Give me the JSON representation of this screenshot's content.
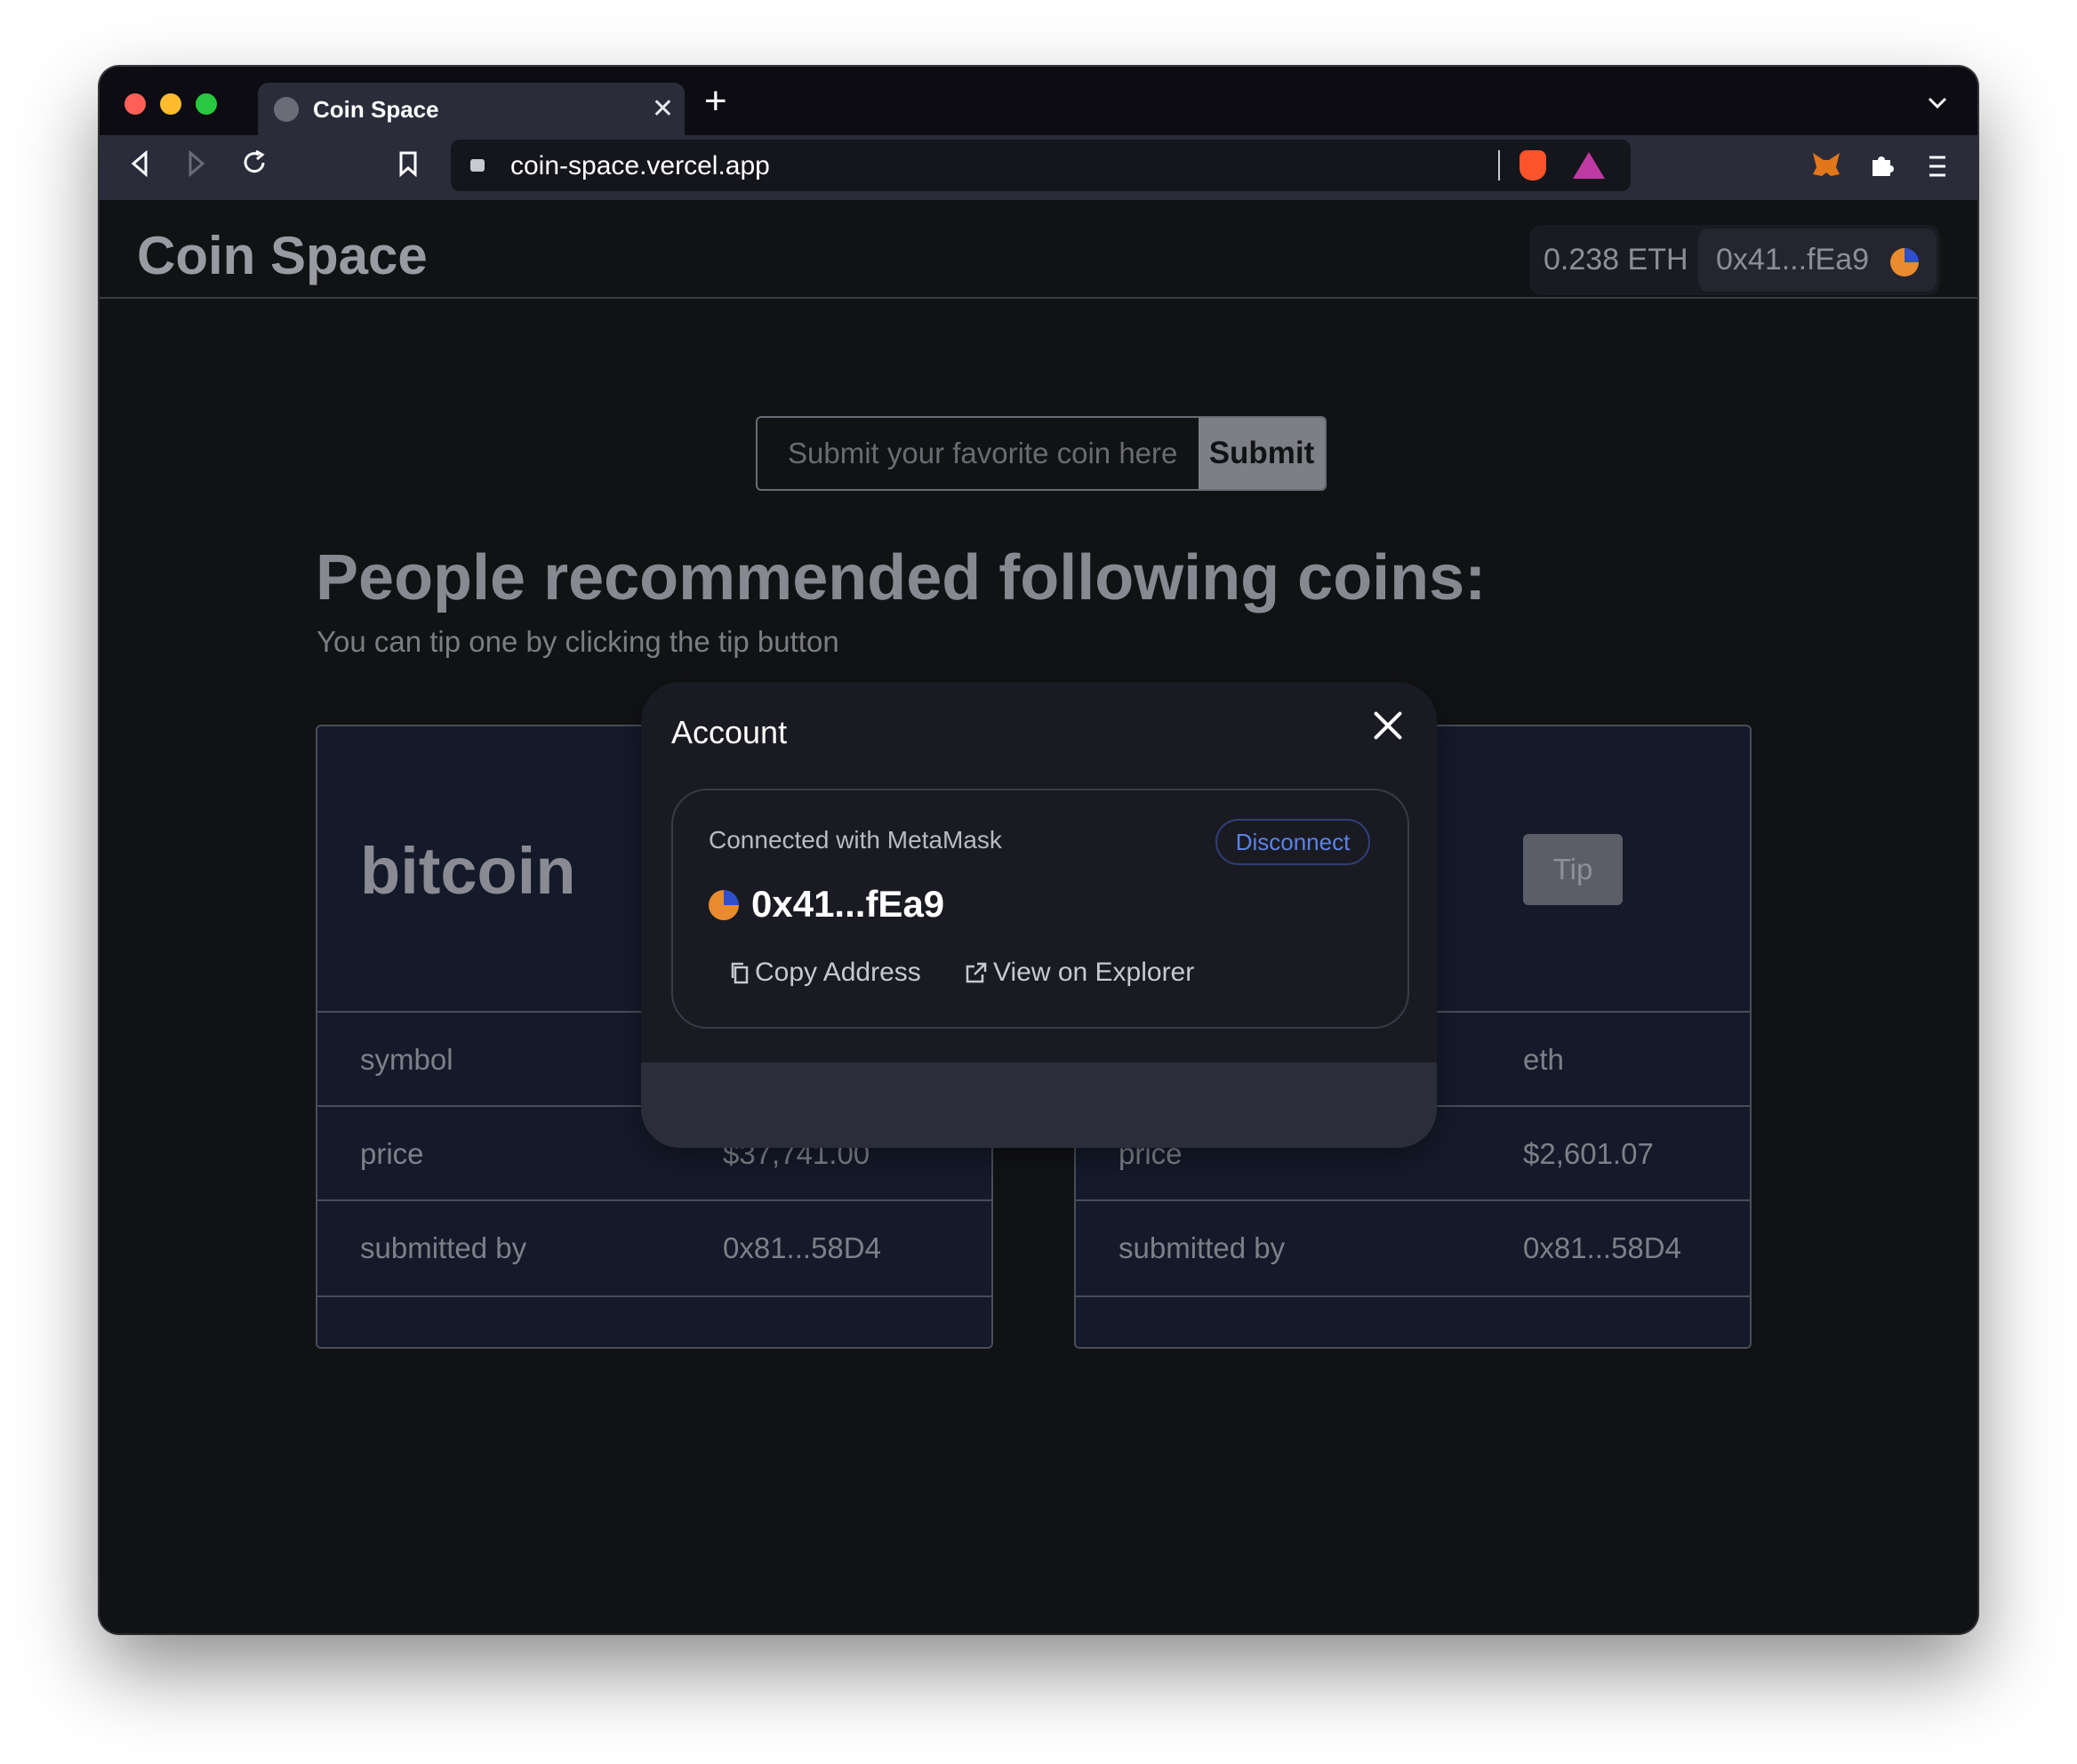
{
  "browser": {
    "tab_title": "Coin Space",
    "tab_close": "✕",
    "new_tab": "+",
    "url": "coin-space.vercel.app"
  },
  "app": {
    "logo": "Coin Space",
    "balance": "0.238 ETH",
    "address": "0x41...fEa9"
  },
  "form": {
    "placeholder": "Submit your favorite coin here",
    "submit_label": "Submit"
  },
  "headline": "People recommended following coins:",
  "subline": "You can tip one by clicking the tip button",
  "cards": [
    {
      "name": "bitcoin",
      "symbol_label": "symbol",
      "symbol": "",
      "price_label": "price",
      "price": "$37,741.00",
      "submitter_label": "submitted by",
      "submitter": "0x81...58D4"
    },
    {
      "name": "",
      "tip_label": "Tip",
      "symbol_label": "",
      "symbol": "eth",
      "price_label": "price",
      "price": "$2,601.07",
      "submitter_label": "submitted by",
      "submitter": "0x81...58D4"
    }
  ],
  "modal": {
    "title": "Account",
    "connected": "Connected with MetaMask",
    "disconnect": "Disconnect",
    "address": "0x41...fEa9",
    "copy_label": "Copy Address",
    "explorer_label": "View on Explorer"
  },
  "colors": {
    "accent_blue": "#5b82e6",
    "avatar_orange": "#e98b2e",
    "avatar_blue": "#2f50c8"
  },
  "icons": [
    "globe-icon",
    "close-icon",
    "plus-icon",
    "back-icon",
    "forward-icon",
    "reload-icon",
    "bookmark-icon",
    "lock-icon",
    "brave-shield-icon",
    "brave-rewards-icon",
    "metamask-icon",
    "extensions-icon",
    "menu-icon",
    "chevron-down-icon",
    "copy-icon",
    "external-link-icon"
  ]
}
